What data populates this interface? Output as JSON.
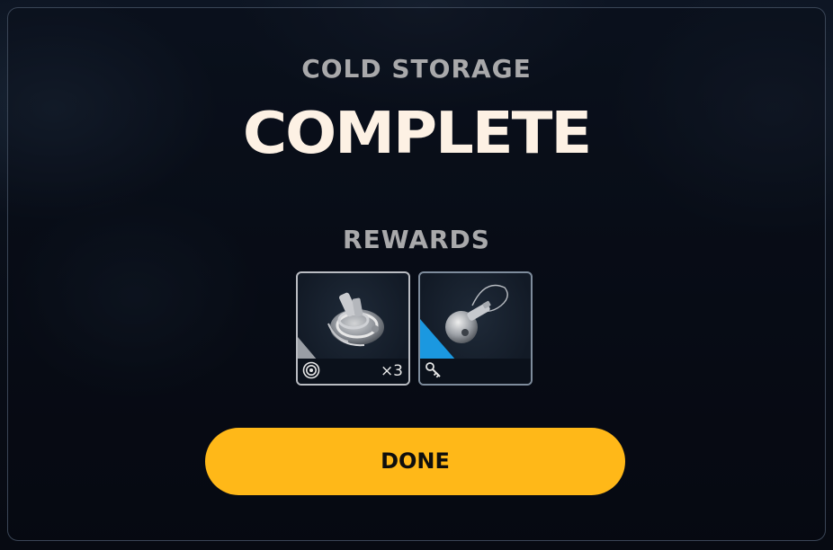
{
  "header": {
    "subtitle": "COLD STORAGE",
    "title": "COMPLETE"
  },
  "rewards": {
    "label": "REWARDS",
    "items": [
      {
        "item_icon": "mechanical-part-icon",
        "type_icon": "target-icon",
        "quantity": "×3",
        "rarity_color": "#9a9ea5"
      },
      {
        "item_icon": "key-icon",
        "type_icon": "key-icon",
        "quantity": "",
        "rarity_color": "#1b98e0"
      }
    ]
  },
  "actions": {
    "done_label": "DONE"
  },
  "colors": {
    "accent": "#ffb818",
    "title": "#fdf1e4",
    "subtitle": "#a9a9ab"
  }
}
